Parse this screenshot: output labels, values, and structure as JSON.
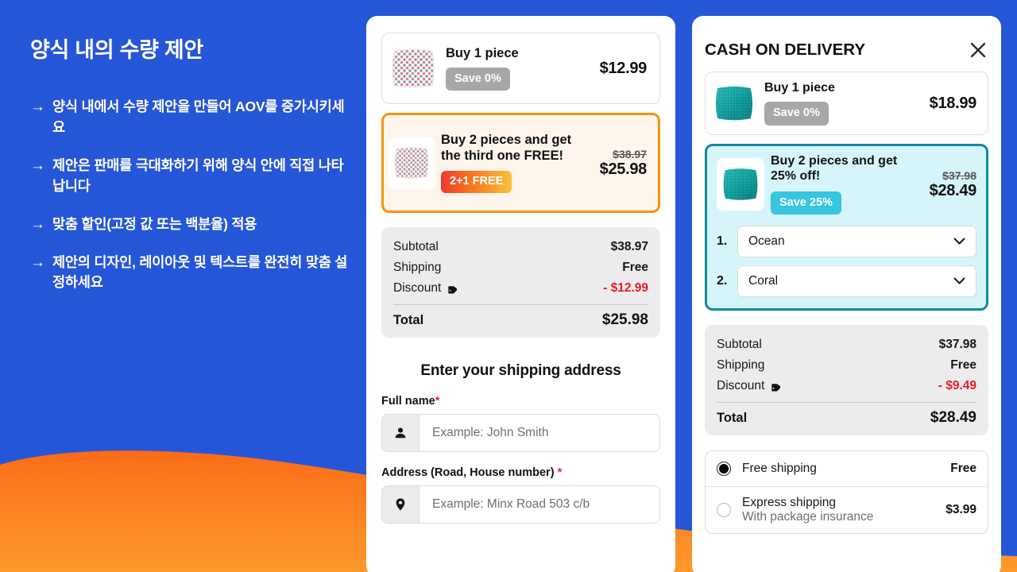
{
  "left": {
    "title": "양식 내의 수량 제안",
    "arrow_glyph": "→",
    "bullets": [
      "양식 내에서 수량 제안을 만들어 AOV를 증가시키세요",
      "제안은 판매를 극대화하기 위해 양식 안에 직접 나타납니다",
      "맞춤 할인(고정 값 또는 백분율) 적용",
      "제안의 디자인, 레이아웃 및 텍스트를 완전히 맞춤 설정하세요"
    ]
  },
  "theme": {
    "background_blue": "#2656d8",
    "wave_orange_top": "#fb6c18",
    "wave_orange_bottom": "#fd9328",
    "selected_orange": "#f5930a",
    "selected_orange_bg": "#fdf5ec",
    "selected_teal": "#0f8b9b",
    "selected_teal_bg": "#d6f5fa",
    "badge_cyan": "#36c6dd",
    "badge_grey": "#a7a7aa",
    "discount_red": "#ec1c24"
  },
  "middle_panel": {
    "offers": [
      {
        "title": "Buy 1 piece",
        "badge": "Save 0%",
        "badge_style": "grey",
        "price": "$12.99",
        "old_price": "",
        "selected": false,
        "thumb": "white-dotted-pillow"
      },
      {
        "title": "Buy 2 pieces and get the third one FREE!",
        "badge": "2+1 FREE",
        "badge_style": "gradient",
        "price": "$25.98",
        "old_price": "$38.97",
        "selected": true,
        "thumb": "white-dotted-pillow"
      }
    ],
    "summary": {
      "subtotal_label": "Subtotal",
      "subtotal_value": "$38.97",
      "shipping_label": "Shipping",
      "shipping_value": "Free",
      "discount_label": "Discount",
      "discount_value": "- $12.99",
      "total_label": "Total",
      "total_value": "$25.98"
    },
    "form": {
      "heading": "Enter your shipping address",
      "fields": [
        {
          "label": "Full name",
          "required": "*",
          "placeholder": "Example: John Smith",
          "icon": "person-icon"
        },
        {
          "label": "Address (Road, House number)",
          "required": "*",
          "placeholder": "Example: Minx Road 503 c/b",
          "icon": "location-pin-icon"
        }
      ]
    }
  },
  "right_panel": {
    "header_title": "CASH ON DELIVERY",
    "close_label": "×",
    "offers": [
      {
        "title": "Buy 1 piece",
        "badge": "Save 0%",
        "badge_style": "grey",
        "price": "$18.99",
        "old_price": "",
        "selected": false,
        "thumb": "teal-pillow"
      },
      {
        "title": "Buy 2 pieces and get 25% off!",
        "badge": "Save 25%",
        "badge_style": "cyan",
        "price": "$28.49",
        "old_price": "$37.98",
        "selected": true,
        "thumb": "teal-pillow"
      }
    ],
    "variants": [
      {
        "num": "1.",
        "value": "Ocean"
      },
      {
        "num": "2.",
        "value": "Coral"
      }
    ],
    "summary": {
      "subtotal_label": "Subtotal",
      "subtotal_value": "$37.98",
      "shipping_label": "Shipping",
      "shipping_value": "Free",
      "discount_label": "Discount",
      "discount_value": "- $9.49",
      "total_label": "Total",
      "total_value": "$28.49"
    },
    "shipping_options": [
      {
        "name": "Free shipping",
        "sub": "",
        "price": "Free",
        "selected": true
      },
      {
        "name": "Express shipping",
        "sub": "With package insurance",
        "price": "$3.99",
        "selected": false
      }
    ]
  }
}
